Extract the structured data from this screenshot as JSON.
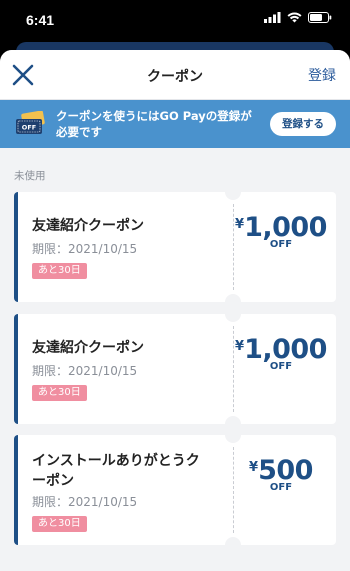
{
  "status": {
    "time": "6:41"
  },
  "nav": {
    "title": "クーポン",
    "action": "登録"
  },
  "banner": {
    "text": "クーポンを使うにはGO Payの登録が必要です",
    "button": "登録する",
    "icon_label": "OFF"
  },
  "section_label": "未使用",
  "coupons": [
    {
      "name": "友達紹介クーポン",
      "expiry": "期限：2021/10/15",
      "badge": "あと30日",
      "currency": "¥",
      "amount": "1,000",
      "unit": "OFF"
    },
    {
      "name": "友達紹介クーポン",
      "expiry": "期限：2021/10/15",
      "badge": "あと30日",
      "currency": "¥",
      "amount": "1,000",
      "unit": "OFF"
    },
    {
      "name": "インストールありがとうクーポン",
      "expiry": "期限：2021/10/15",
      "badge": "あと30日",
      "currency": "¥",
      "amount": "500",
      "unit": "OFF"
    }
  ],
  "colors": {
    "accent": "#1e4f86",
    "banner": "#4a92cd",
    "badge": "#f08ea0"
  }
}
